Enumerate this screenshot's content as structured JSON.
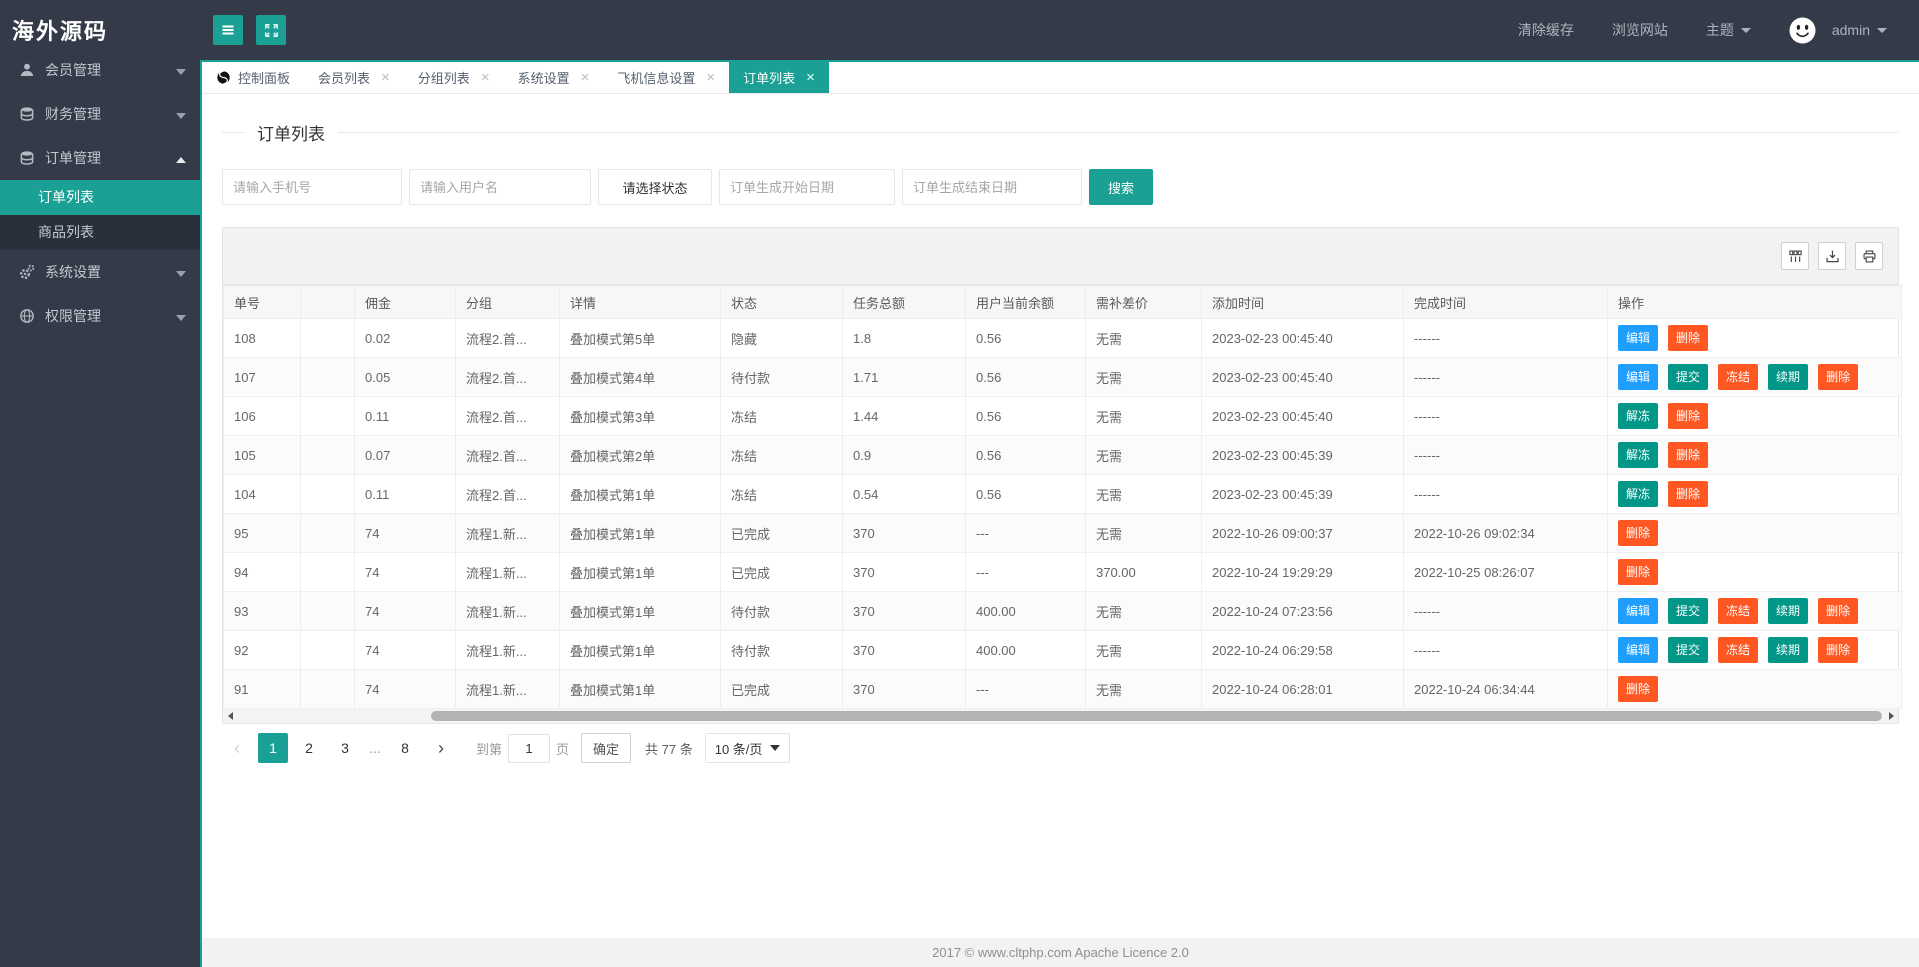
{
  "app": {
    "logo_text": "海外源码",
    "footer_text": "2017 ©  www.cltphp.com  Apache Licence 2.0"
  },
  "topbar": {
    "clear_cache": "清除缓存",
    "browse_site": "浏览网站",
    "theme": "主题",
    "username": "admin"
  },
  "sidebar": {
    "items": [
      {
        "id": "member",
        "label": "会员管理",
        "icon": "user-icon",
        "expanded": false
      },
      {
        "id": "finance",
        "label": "财务管理",
        "icon": "database-icon",
        "expanded": false
      },
      {
        "id": "order",
        "label": "订单管理",
        "icon": "database-icon",
        "expanded": true,
        "children": [
          {
            "id": "order-list",
            "label": "订单列表",
            "active": true
          },
          {
            "id": "goods-list",
            "label": "商品列表",
            "active": false
          }
        ]
      },
      {
        "id": "system",
        "label": "系统设置",
        "icon": "gear-icon",
        "expanded": false
      },
      {
        "id": "permission",
        "label": "权限管理",
        "icon": "globe-icon",
        "expanded": false
      }
    ]
  },
  "tabs": [
    {
      "id": "dashboard",
      "label": "控制面板",
      "icon": "dashboard-icon",
      "closable": false,
      "active": false
    },
    {
      "id": "member-list",
      "label": "会员列表",
      "closable": true,
      "active": false
    },
    {
      "id": "group-list",
      "label": "分组列表",
      "closable": true,
      "active": false
    },
    {
      "id": "system-settings",
      "label": "系统设置",
      "closable": true,
      "active": false
    },
    {
      "id": "flight-info-settings",
      "label": "飞机信息设置",
      "closable": true,
      "active": false
    },
    {
      "id": "order-list",
      "label": "订单列表",
      "closable": true,
      "active": true
    }
  ],
  "page": {
    "title": "订单列表"
  },
  "filters": {
    "phone_placeholder": "请输入手机号",
    "username_placeholder": "请输入用户名",
    "status_label": "请选择状态",
    "start_date_placeholder": "订单生成开始日期",
    "end_date_placeholder": "订单生成结束日期",
    "search_label": "搜索"
  },
  "toolbar_icons": [
    "columns-icon",
    "export-icon",
    "print-icon"
  ],
  "table": {
    "columns": [
      "单号",
      "",
      "佣金",
      "分组",
      "详情",
      "状态",
      "任务总额",
      "用户当前余额",
      "需补差价",
      "添加时间",
      "完成时间",
      "操作"
    ],
    "rows": [
      {
        "cells": [
          "108",
          "",
          "0.02",
          "流程2.首...",
          "叠加模式第5单",
          "隐藏",
          "1.8",
          "0.56",
          "无需",
          "2023-02-23 00:45:40",
          "------"
        ],
        "actions": [
          {
            "id": "edit",
            "label": "编辑",
            "color": "blue"
          },
          {
            "id": "delete",
            "label": "删除",
            "color": "orange"
          }
        ]
      },
      {
        "cells": [
          "107",
          "",
          "0.05",
          "流程2.首...",
          "叠加模式第4单",
          "待付款",
          "1.71",
          "0.56",
          "无需",
          "2023-02-23 00:45:40",
          "------"
        ],
        "actions": [
          {
            "id": "edit",
            "label": "编辑",
            "color": "blue"
          },
          {
            "id": "submit",
            "label": "提交",
            "color": "teal"
          },
          {
            "id": "freeze",
            "label": "冻结",
            "color": "orange"
          },
          {
            "id": "renew",
            "label": "续期",
            "color": "teal"
          },
          {
            "id": "delete",
            "label": "删除",
            "color": "orange"
          }
        ]
      },
      {
        "cells": [
          "106",
          "",
          "0.11",
          "流程2.首...",
          "叠加模式第3单",
          "冻结",
          "1.44",
          "0.56",
          "无需",
          "2023-02-23 00:45:40",
          "------"
        ],
        "actions": [
          {
            "id": "unfreeze",
            "label": "解冻",
            "color": "teal"
          },
          {
            "id": "delete",
            "label": "删除",
            "color": "orange"
          }
        ]
      },
      {
        "cells": [
          "105",
          "",
          "0.07",
          "流程2.首...",
          "叠加模式第2单",
          "冻结",
          "0.9",
          "0.56",
          "无需",
          "2023-02-23 00:45:39",
          "------"
        ],
        "actions": [
          {
            "id": "unfreeze",
            "label": "解冻",
            "color": "teal"
          },
          {
            "id": "delete",
            "label": "删除",
            "color": "orange"
          }
        ]
      },
      {
        "cells": [
          "104",
          "",
          "0.11",
          "流程2.首...",
          "叠加模式第1单",
          "冻结",
          "0.54",
          "0.56",
          "无需",
          "2023-02-23 00:45:39",
          "------"
        ],
        "actions": [
          {
            "id": "unfreeze",
            "label": "解冻",
            "color": "teal"
          },
          {
            "id": "delete",
            "label": "删除",
            "color": "orange"
          }
        ]
      },
      {
        "cells": [
          "95",
          "",
          "74",
          "流程1.新...",
          "叠加模式第1单",
          "已完成",
          "370",
          "---",
          "无需",
          "2022-10-26 09:00:37",
          "2022-10-26 09:02:34"
        ],
        "actions": [
          {
            "id": "delete",
            "label": "删除",
            "color": "orange"
          }
        ]
      },
      {
        "cells": [
          "94",
          "",
          "74",
          "流程1.新...",
          "叠加模式第1单",
          "已完成",
          "370",
          "---",
          "370.00",
          "2022-10-24 19:29:29",
          "2022-10-25 08:26:07"
        ],
        "actions": [
          {
            "id": "delete",
            "label": "删除",
            "color": "orange"
          }
        ]
      },
      {
        "cells": [
          "93",
          "",
          "74",
          "流程1.新...",
          "叠加模式第1单",
          "待付款",
          "370",
          "400.00",
          "无需",
          "2022-10-24 07:23:56",
          "------"
        ],
        "actions": [
          {
            "id": "edit",
            "label": "编辑",
            "color": "blue"
          },
          {
            "id": "submit",
            "label": "提交",
            "color": "teal"
          },
          {
            "id": "freeze",
            "label": "冻结",
            "color": "orange"
          },
          {
            "id": "renew",
            "label": "续期",
            "color": "teal"
          },
          {
            "id": "delete",
            "label": "删除",
            "color": "orange"
          }
        ]
      },
      {
        "cells": [
          "92",
          "",
          "74",
          "流程1.新...",
          "叠加模式第1单",
          "待付款",
          "370",
          "400.00",
          "无需",
          "2022-10-24 06:29:58",
          "------"
        ],
        "actions": [
          {
            "id": "edit",
            "label": "编辑",
            "color": "blue"
          },
          {
            "id": "submit",
            "label": "提交",
            "color": "teal"
          },
          {
            "id": "freeze",
            "label": "冻结",
            "color": "orange"
          },
          {
            "id": "renew",
            "label": "续期",
            "color": "teal"
          },
          {
            "id": "delete",
            "label": "删除",
            "color": "orange"
          }
        ]
      },
      {
        "cells": [
          "91",
          "",
          "74",
          "流程1.新...",
          "叠加模式第1单",
          "已完成",
          "370",
          "---",
          "无需",
          "2022-10-24 06:28:01",
          "2022-10-24 06:34:44"
        ],
        "actions": [
          {
            "id": "delete",
            "label": "删除",
            "color": "orange"
          }
        ]
      }
    ]
  },
  "pagination": {
    "prev": "‹",
    "next": "›",
    "pages": [
      "1",
      "2",
      "3",
      "...",
      "8"
    ],
    "current": "1",
    "jump_prefix": "到第",
    "jump_value": "1",
    "jump_suffix": "页",
    "confirm_label": "确定",
    "total_label": "共 77 条",
    "page_size_label": "10 条/页"
  },
  "colors": {
    "accent": "#1aa094",
    "button_blue": "#1e9fff",
    "button_teal": "#009688",
    "button_orange": "#ff5722",
    "sidebar_dark": "#343a47",
    "sidebar_submenu": "#2a303b"
  }
}
